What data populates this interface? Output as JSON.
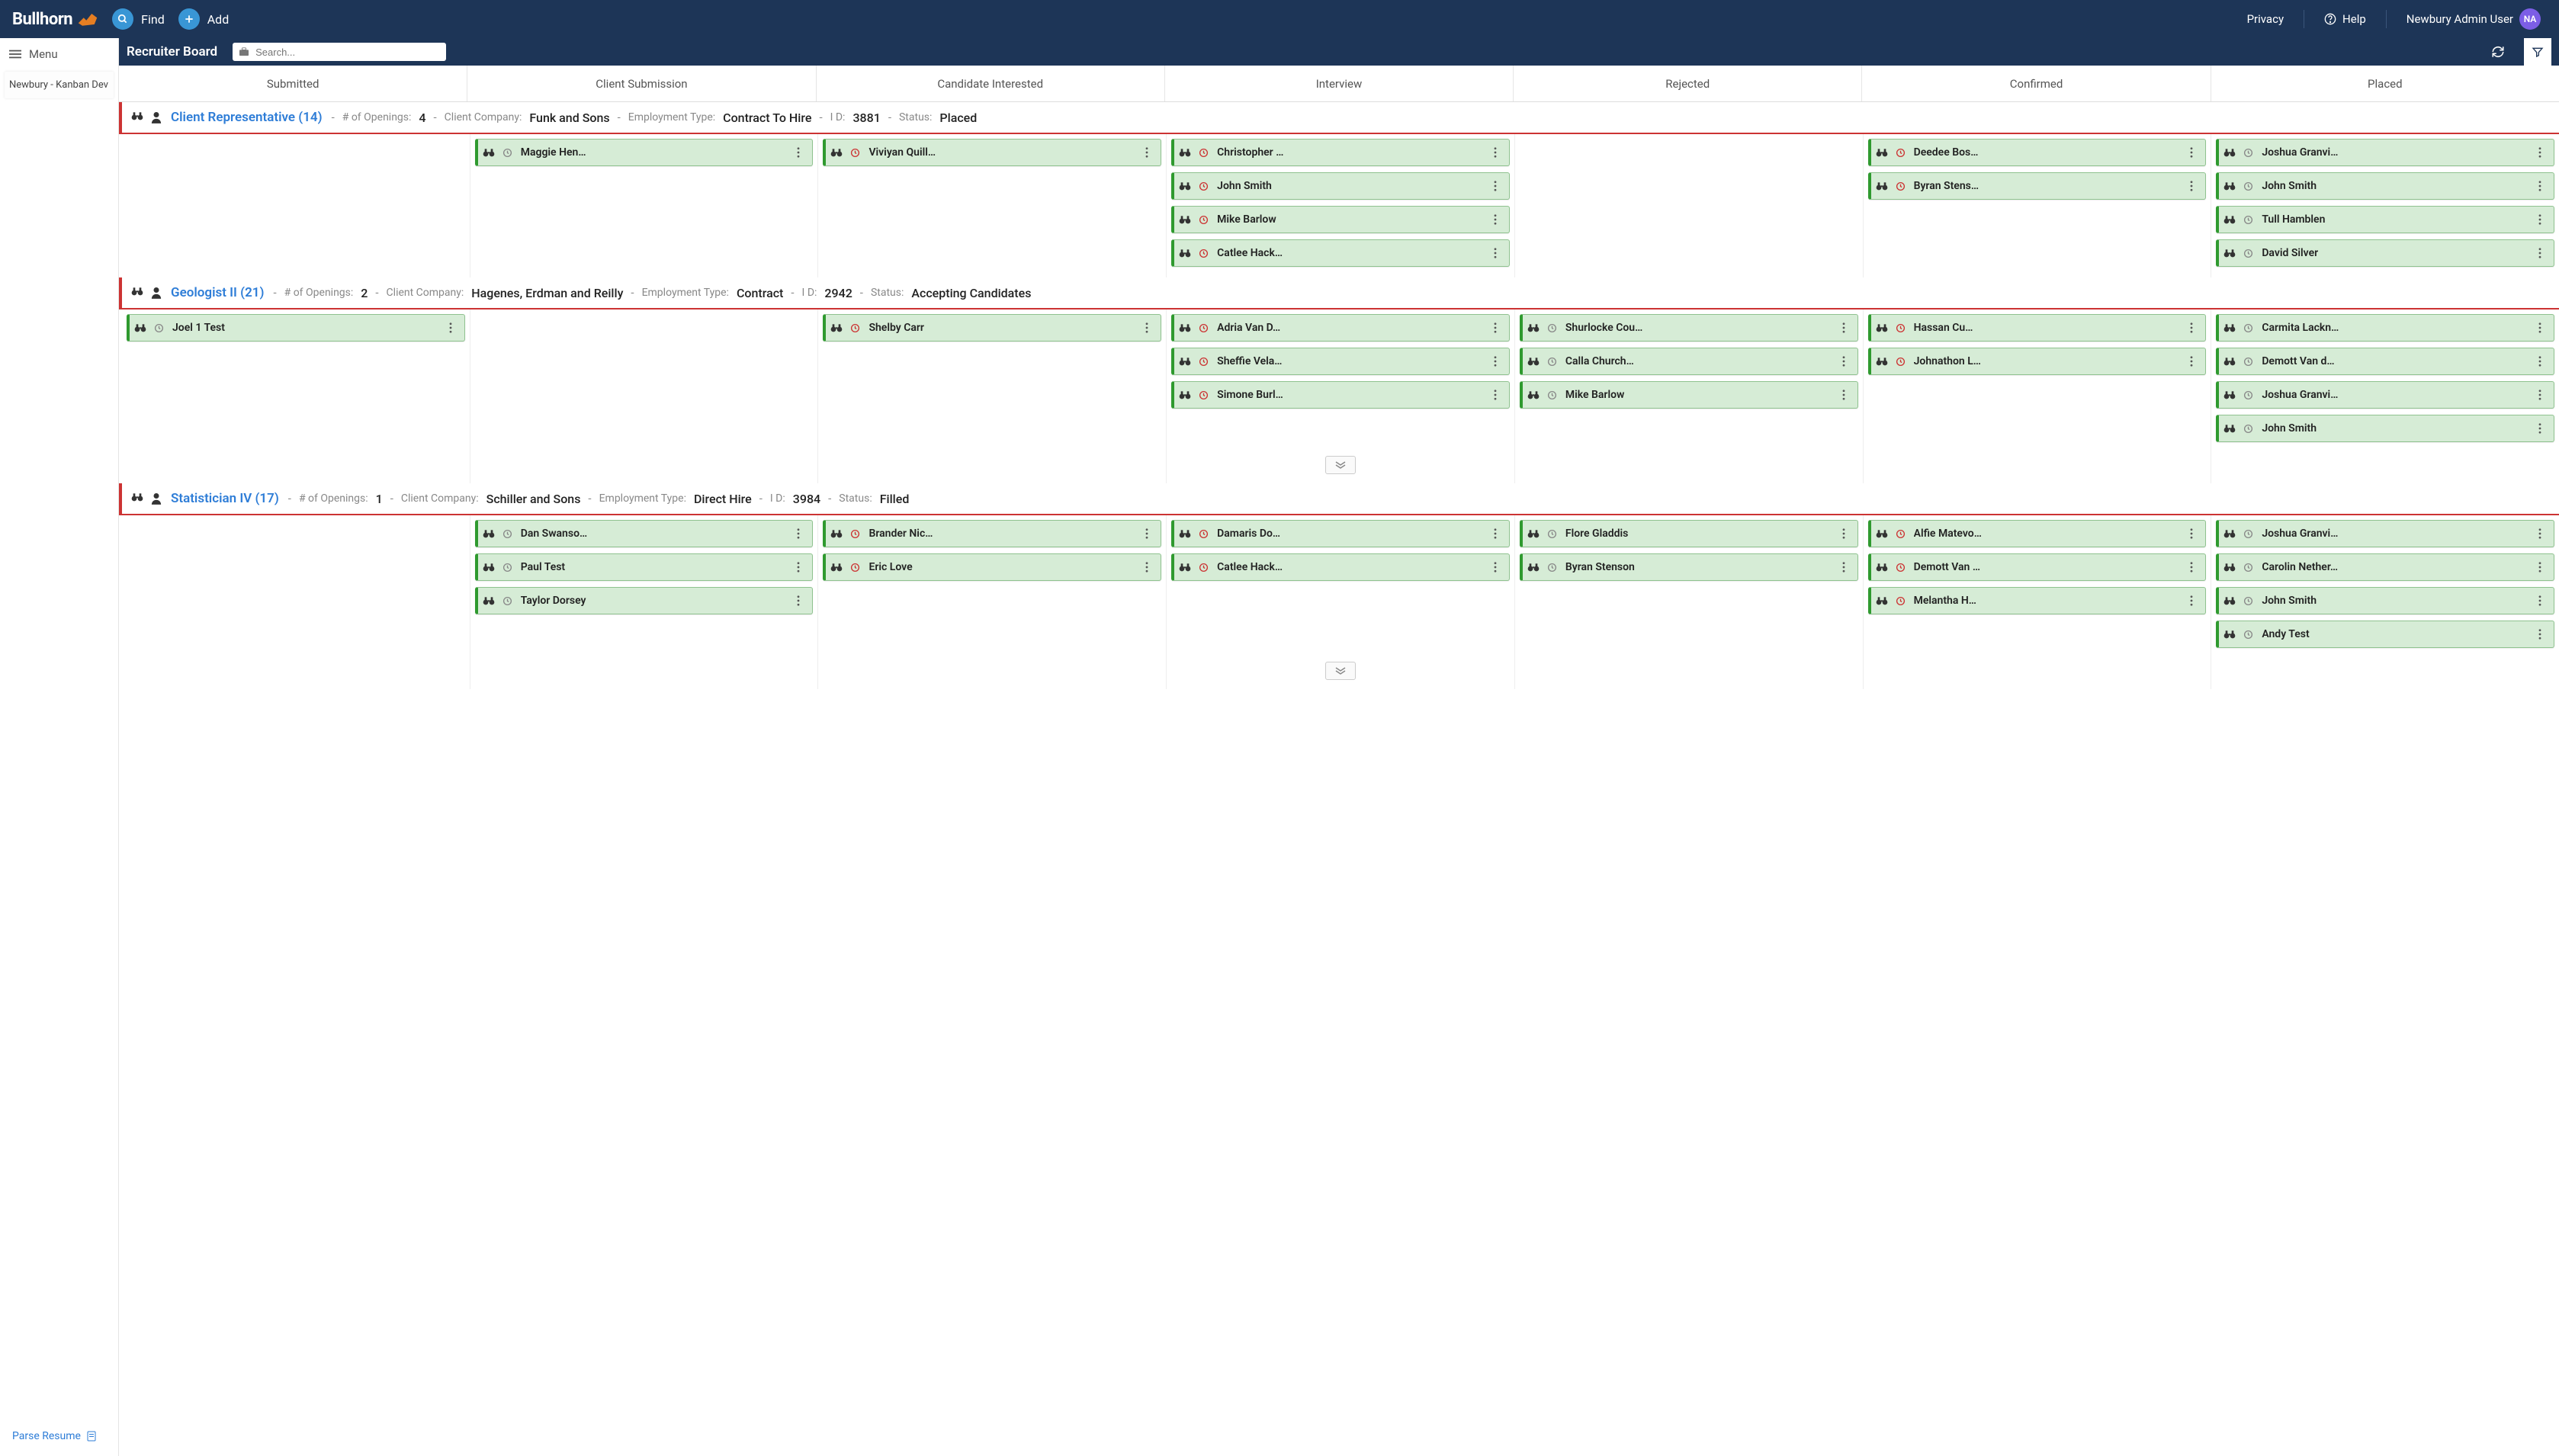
{
  "nav": {
    "logo_text": "Bullhorn",
    "find": "Find",
    "add": "Add",
    "privacy": "Privacy",
    "help": "Help",
    "user": "Newbury Admin User",
    "avatar": "NA"
  },
  "sidebar": {
    "menu": "Menu",
    "tab1": "Newbury - Kanban Dev",
    "parse": "Parse Resume"
  },
  "header": {
    "title": "Recruiter Board",
    "search_placeholder": "Search..."
  },
  "columns": [
    "Submitted",
    "Client Submission",
    "Candidate Interested",
    "Interview",
    "Rejected",
    "Confirmed",
    "Placed"
  ],
  "lanes": [
    {
      "title_text": "Client Representative (14)",
      "meta": [
        {
          "lbl": "# of Openings:",
          "val": "4"
        },
        {
          "lbl": "Client Company:",
          "val": "Funk and Sons"
        },
        {
          "lbl": "Employment Type:",
          "val": "Contract To Hire"
        },
        {
          "lbl": "I D:",
          "val": "3881"
        },
        {
          "lbl": "Status:",
          "val": "Placed"
        }
      ],
      "cells": [
        [],
        [
          {
            "name": "Maggie Hen…",
            "clock": false
          }
        ],
        [
          {
            "name": "Viviyan Quill…",
            "clock": true
          }
        ],
        [
          {
            "name": "Christopher …",
            "clock": true
          },
          {
            "name": "John Smith",
            "clock": true
          },
          {
            "name": "Mike Barlow",
            "clock": true
          },
          {
            "name": "Catlee Hack…",
            "clock": true
          }
        ],
        [],
        [
          {
            "name": "Deedee Bos…",
            "clock": true
          },
          {
            "name": "Byran Stens…",
            "clock": true
          }
        ],
        [
          {
            "name": "Joshua Granvi…",
            "clock": false
          },
          {
            "name": "John Smith",
            "clock": false
          },
          {
            "name": "Tull Hamblen",
            "clock": false
          },
          {
            "name": "David Silver",
            "clock": false
          }
        ]
      ],
      "expanders": []
    },
    {
      "title_text": "Geologist II (21)",
      "meta": [
        {
          "lbl": "# of Openings:",
          "val": "2"
        },
        {
          "lbl": "Client Company:",
          "val": "Hagenes, Erdman and Reilly"
        },
        {
          "lbl": "Employment Type:",
          "val": "Contract"
        },
        {
          "lbl": "I D:",
          "val": "2942"
        },
        {
          "lbl": "Status:",
          "val": "Accepting Candidates"
        }
      ],
      "cells": [
        [
          {
            "name": "Joel 1 Test",
            "clock": false
          }
        ],
        [],
        [
          {
            "name": "Shelby Carr",
            "clock": true
          }
        ],
        [
          {
            "name": "Adria Van D…",
            "clock": true
          },
          {
            "name": "Sheffie Vela…",
            "clock": true
          },
          {
            "name": "Simone Burl…",
            "clock": true
          }
        ],
        [
          {
            "name": "Shurlocke Cou…",
            "clock": false
          },
          {
            "name": "Calla Church…",
            "clock": false
          },
          {
            "name": "Mike Barlow",
            "clock": false
          }
        ],
        [
          {
            "name": "Hassan Cu…",
            "clock": true
          },
          {
            "name": "Johnathon L…",
            "clock": true
          }
        ],
        [
          {
            "name": "Carmita Lackn…",
            "clock": false
          },
          {
            "name": "Demott Van d…",
            "clock": false
          },
          {
            "name": "Joshua Granvi…",
            "clock": false
          },
          {
            "name": "John Smith",
            "clock": false
          }
        ]
      ],
      "expanders": [
        3
      ]
    },
    {
      "title_text": "Statistician IV (17)",
      "meta": [
        {
          "lbl": "# of Openings:",
          "val": "1"
        },
        {
          "lbl": "Client Company:",
          "val": "Schiller and Sons"
        },
        {
          "lbl": "Employment Type:",
          "val": "Direct Hire"
        },
        {
          "lbl": "I D:",
          "val": "3984"
        },
        {
          "lbl": "Status:",
          "val": "Filled"
        }
      ],
      "cells": [
        [],
        [
          {
            "name": "Dan Swanso…",
            "clock": false
          },
          {
            "name": "Paul Test",
            "clock": false
          },
          {
            "name": "Taylor Dorsey",
            "clock": false
          }
        ],
        [
          {
            "name": "Brander Nic…",
            "clock": true
          },
          {
            "name": "Eric Love",
            "clock": true
          }
        ],
        [
          {
            "name": "Damaris Do…",
            "clock": true
          },
          {
            "name": "Catlee Hack…",
            "clock": true
          }
        ],
        [
          {
            "name": "Flore Gladdis",
            "clock": false
          },
          {
            "name": "Byran Stenson",
            "clock": false
          }
        ],
        [
          {
            "name": "Alfie Matevo…",
            "clock": true
          },
          {
            "name": "Demott Van …",
            "clock": true
          },
          {
            "name": "Melantha H…",
            "clock": true
          }
        ],
        [
          {
            "name": "Joshua Granvi…",
            "clock": false
          },
          {
            "name": "Carolin Nether…",
            "clock": false
          },
          {
            "name": "John Smith",
            "clock": false
          },
          {
            "name": "Andy Test",
            "clock": false
          }
        ]
      ],
      "expanders": [
        3
      ]
    }
  ]
}
